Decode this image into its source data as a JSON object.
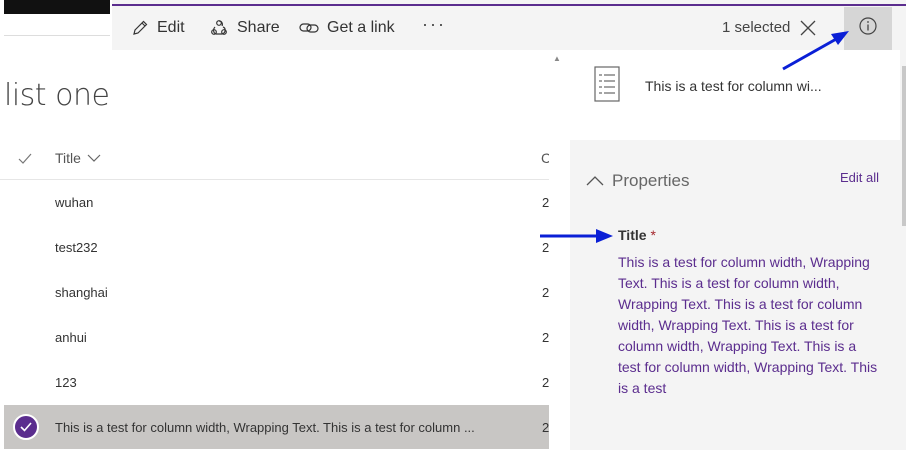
{
  "toolbar": {
    "edit_label": "Edit",
    "share_label": "Share",
    "get_link_label": "Get a link",
    "more_label": "···",
    "selected_label": "1 selected",
    "icons": {
      "edit": "pencil-icon",
      "share": "share-icon",
      "link": "link-icon",
      "close": "close-icon",
      "info": "info-icon"
    }
  },
  "list": {
    "title": "list one",
    "columns": [
      "Title",
      "C"
    ],
    "rows": [
      {
        "title": "wuhan",
        "col2": "2"
      },
      {
        "title": "test232",
        "col2": "2"
      },
      {
        "title": "shanghai",
        "col2": "2"
      },
      {
        "title": "anhui",
        "col2": "2"
      },
      {
        "title": "123",
        "col2": "2"
      },
      {
        "title": "This is a test for column width, Wrapping Text. This is a test for column ...",
        "col2": "2",
        "selected": true
      }
    ]
  },
  "details": {
    "file_name": "This is a test for column wi...",
    "properties_label": "Properties",
    "edit_all_label": "Edit all",
    "field": {
      "label": "Title",
      "required_mark": "*",
      "value": "This is a test for column width, Wrapping Text. This is a test for column width, Wrapping Text. This is a test for column width, Wrapping Text. This is a test for column width, Wrapping Text. This is a test for column width, Wrapping Text. This is a test"
    }
  },
  "colors": {
    "accent": "#5b2d8e",
    "annotation_arrow": "#0a1fd6",
    "selected_row": "#c8c6c4"
  }
}
